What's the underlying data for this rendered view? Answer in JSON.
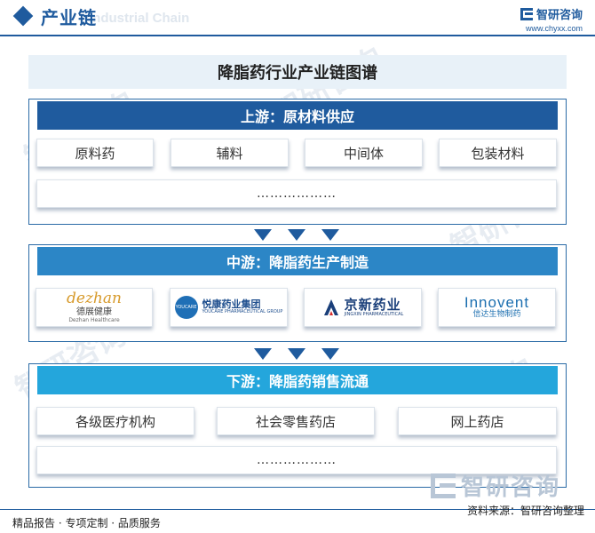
{
  "header": {
    "title": "产业链",
    "subtitle": "Industrial Chain",
    "logo_name": "智研咨询",
    "logo_url": "www.chyxx.com"
  },
  "chart_title": "降脂药行业产业链图谱",
  "upstream": {
    "heading": "上游：原材料供应",
    "items": [
      "原料药",
      "辅料",
      "中间体",
      "包装材料"
    ],
    "more": "………………"
  },
  "midstream": {
    "heading": "中游：降脂药生产制造",
    "companies": [
      {
        "brand": "dezhan",
        "name_cn": "德展健康",
        "name_en": "Dezhan Healthcare"
      },
      {
        "brand": "YOUCARE",
        "name_cn": "悦康药业集团",
        "name_en": "YOUCARE PHARMACEUTICAL GROUP"
      },
      {
        "brand": "京新药业",
        "name_en": "JINGXIN PHARMACEUTICAL"
      },
      {
        "brand": "Innovent",
        "name_cn": "信达生物制药"
      }
    ]
  },
  "downstream": {
    "heading": "下游：降脂药销售流通",
    "items": [
      "各级医疗机构",
      "社会零售药店",
      "网上药店"
    ],
    "more": "………………"
  },
  "footer": {
    "left": "精品报告 · 专项定制 · 品质服务",
    "source": "资料来源：智研咨询整理",
    "brand_watermark": "智研咨询"
  },
  "colors": {
    "upstream_head": "#1f5b9e",
    "midstream_head": "#2c86c6",
    "downstream_head": "#24a6dc",
    "arrow": "#1f5b9e"
  }
}
